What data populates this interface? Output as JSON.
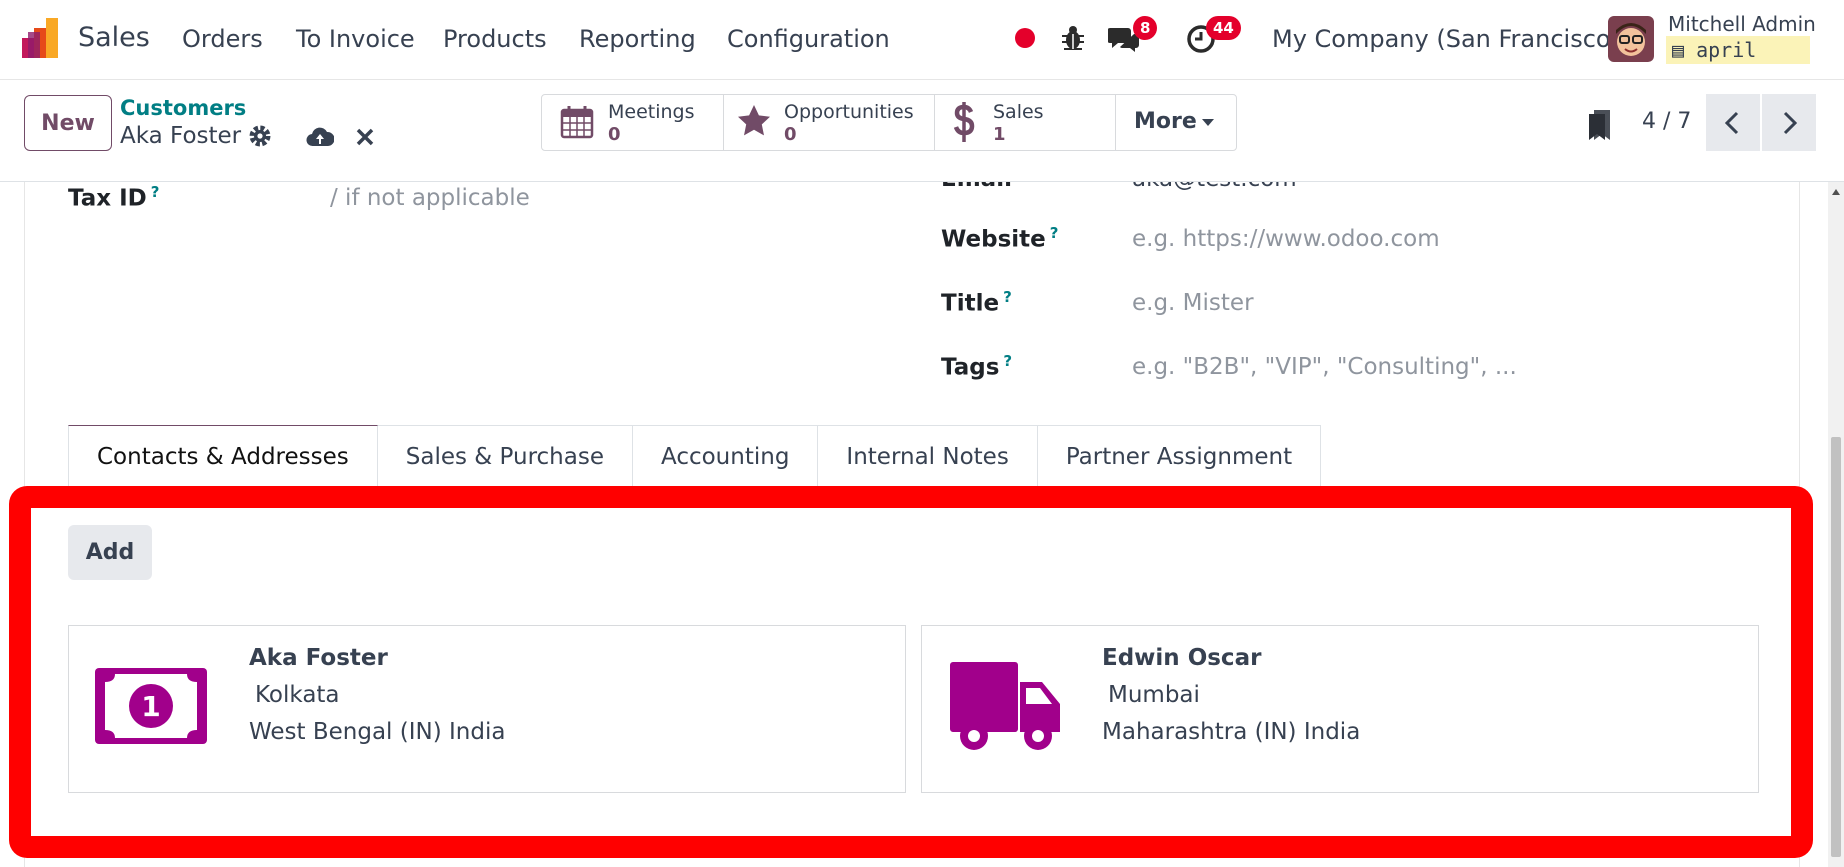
{
  "navbar": {
    "app_name": "Sales",
    "menu": [
      "Orders",
      "To Invoice",
      "Products",
      "Reporting",
      "Configuration"
    ],
    "messages_count": "8",
    "activities_count": "44",
    "company": "My Company (San Francisco)",
    "user_name": "Mitchell Admin",
    "database": "april"
  },
  "control": {
    "new_label": "New",
    "breadcrumb_parent": "Customers",
    "breadcrumb_current": "Aka Foster",
    "smart_buttons": [
      {
        "label": "Meetings",
        "value": "0",
        "icon": "calendar-icon"
      },
      {
        "label": "Opportunities",
        "value": "0",
        "icon": "star-icon"
      },
      {
        "label": "Sales",
        "value": "1",
        "icon": "dollar-icon"
      }
    ],
    "more_label": "More",
    "pager": "4 / 7"
  },
  "form": {
    "tax_id_label": "Tax ID",
    "tax_id_placeholder": "/ if not applicable",
    "email_label_cut": "Email",
    "email_value_cut": "aka@test.com",
    "website_label": "Website",
    "website_placeholder": "e.g. https://www.odoo.com",
    "title_label": "Title",
    "title_placeholder": "e.g. Mister",
    "tags_label": "Tags",
    "tags_placeholder": "e.g. \"B2B\", \"VIP\", \"Consulting\", ...",
    "help_mark": "?"
  },
  "tabs": [
    "Contacts & Addresses",
    "Sales & Purchase",
    "Accounting",
    "Internal Notes",
    "Partner Assignment"
  ],
  "contacts": {
    "add_label": "Add",
    "cards": [
      {
        "name": "Aka Foster",
        "city": "Kolkata",
        "region": "West Bengal (IN) India",
        "icon": "invoice-address-icon"
      },
      {
        "name": "Edwin Oscar",
        "city": "Mumbai",
        "region": "Maharashtra (IN) India",
        "icon": "delivery-truck-icon"
      }
    ]
  },
  "colors": {
    "brand": "#714b67",
    "link": "#017e84",
    "badge": "#e4002b",
    "card_icon": "#a1008b",
    "highlight": "#ff0000"
  }
}
